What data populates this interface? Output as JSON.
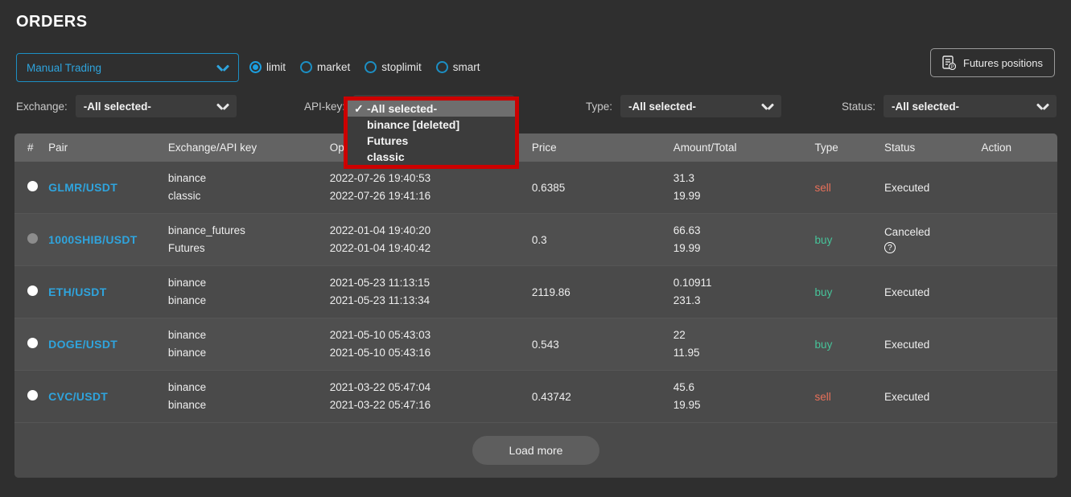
{
  "header": {
    "title": "ORDERS",
    "mode_select": {
      "value": "Manual Trading",
      "icon": "chevron-down-icon"
    },
    "order_types": [
      {
        "label": "limit",
        "selected": true
      },
      {
        "label": "market",
        "selected": false
      },
      {
        "label": "stoplimit",
        "selected": false
      },
      {
        "label": "smart",
        "selected": false
      }
    ],
    "futures_button": {
      "label": "Futures positions",
      "icon": "document-positions-icon"
    }
  },
  "filters": [
    {
      "name": "exchange",
      "label": "Exchange:",
      "value": "-All selected-"
    },
    {
      "name": "apikey",
      "label": "API-key:",
      "value": "-All selected-"
    },
    {
      "name": "type",
      "label": "Type:",
      "value": "-All selected-"
    },
    {
      "name": "status",
      "label": "Status:",
      "value": "-All selected-"
    }
  ],
  "open_dropdown": {
    "for": "api-key",
    "highlight_color": "#cc0000",
    "items": [
      {
        "label": "-All selected-",
        "checked": true
      },
      {
        "label": "binance [deleted]",
        "checked": false
      },
      {
        "label": "Futures",
        "checked": false
      },
      {
        "label": "classic",
        "checked": false
      }
    ]
  },
  "table": {
    "columns": [
      "#",
      "Pair",
      "Exchange/API key",
      "Op",
      "Price",
      "Amount/Total",
      "Type",
      "Status",
      "Action"
    ],
    "rows": [
      {
        "indicator": "white",
        "pair": "GLMR/USDT",
        "exchange": "binance",
        "apikey": "classic",
        "date_open": "2022-07-26 19:40:53",
        "date_close": "2022-07-26 19:41:16",
        "price": "0.6385",
        "amount": "31.3",
        "total": "19.99",
        "type": "sell",
        "status": "Executed",
        "status_help": "",
        "action": ""
      },
      {
        "indicator": "dim",
        "pair": "1000SHIB/USDT",
        "exchange": "binance_futures",
        "apikey": "Futures",
        "date_open": "2022-01-04 19:40:20",
        "date_close": "2022-01-04 19:40:42",
        "price": "0.3",
        "amount": "66.63",
        "total": "19.99",
        "type": "buy",
        "status": "Canceled",
        "status_help": "?",
        "action": ""
      },
      {
        "indicator": "white",
        "pair": "ETH/USDT",
        "exchange": "binance",
        "apikey": "binance",
        "date_open": "2021-05-23 11:13:15",
        "date_close": "2021-05-23 11:13:34",
        "price": "2119.86",
        "amount": "0.10911",
        "total": "231.3",
        "type": "buy",
        "status": "Executed",
        "status_help": "",
        "action": ""
      },
      {
        "indicator": "white",
        "pair": "DOGE/USDT",
        "exchange": "binance",
        "apikey": "binance",
        "date_open": "2021-05-10 05:43:03",
        "date_close": "2021-05-10 05:43:16",
        "price": "0.543",
        "amount": "22",
        "total": "11.95",
        "type": "buy",
        "status": "Executed",
        "status_help": "",
        "action": ""
      },
      {
        "indicator": "white",
        "pair": "CVC/USDT",
        "exchange": "binance",
        "apikey": "binance",
        "date_open": "2021-03-22 05:47:04",
        "date_close": "2021-03-22 05:47:16",
        "price": "0.43742",
        "amount": "45.6",
        "total": "19.95",
        "type": "sell",
        "status": "Executed",
        "status_help": "",
        "action": ""
      }
    ],
    "load_more_label": "Load more"
  },
  "colors": {
    "accent_blue": "#2fa4dd",
    "buy_green": "#46c49a",
    "sell_red": "#e8705a",
    "highlight_red": "#cc0000",
    "page_bg": "#2f2f2f",
    "panel_bg": "#4a4a4a",
    "header_bg": "#636363"
  }
}
